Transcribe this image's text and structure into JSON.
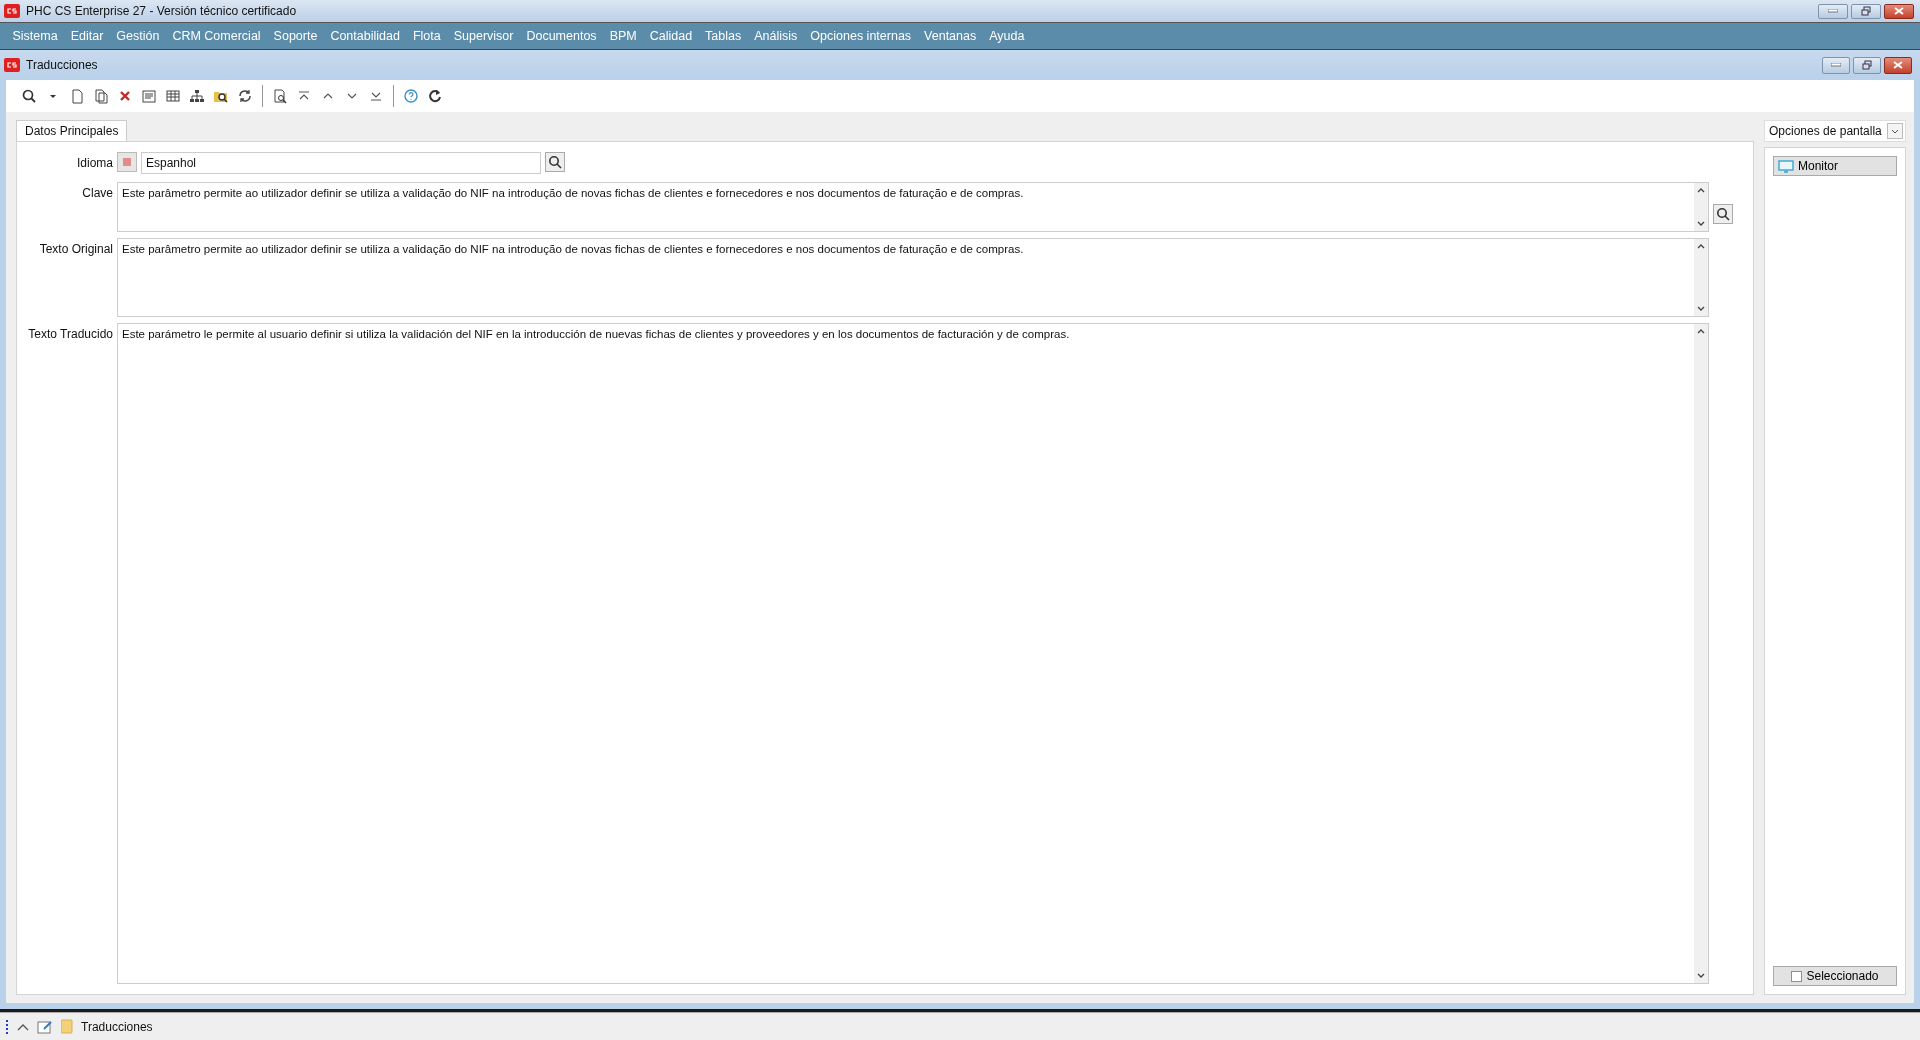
{
  "window": {
    "title": "PHC CS Enterprise 27 - Versión técnico certificado"
  },
  "menu": [
    "Sistema",
    "Editar",
    "Gestión",
    "CRM Comercial",
    "Soporte",
    "Contabilidad",
    "Flota",
    "Supervisor",
    "Documentos",
    "BPM",
    "Calidad",
    "Tablas",
    "Análisis",
    "Opciones internas",
    "Ventanas",
    "Ayuda"
  ],
  "form_window": {
    "title": "Traducciones"
  },
  "tabs": [
    {
      "label": "Datos Principales",
      "selected": true
    }
  ],
  "form": {
    "idioma": {
      "label": "Idioma",
      "value": "Espanhol"
    },
    "clave": {
      "label": "Clave",
      "value": "Este parâmetro permite ao utilizador definir se utiliza a validação do NIF na introdução de novas fichas de clientes e fornecedores e nos documentos de faturação e de compras."
    },
    "texto_original": {
      "label": "Texto Original",
      "value": "Este parâmetro permite ao utilizador definir se utiliza a validação do NIF na introdução de novas fichas de clientes e fornecedores e nos documentos de faturação e de compras."
    },
    "texto_traducido": {
      "label": "Texto Traducido",
      "value": "Este parámetro le permite al usuario definir si utiliza la validación del NIF en la introducción de nuevas fichas de clientes y proveedores y en los documentos de facturación y de compras."
    }
  },
  "side_panel": {
    "dropdown": "Opciones de pantalla",
    "button": "Monitor",
    "checkbox": {
      "label": "Seleccionado",
      "checked": false
    }
  },
  "status_bar": {
    "label": "Traducciones"
  }
}
